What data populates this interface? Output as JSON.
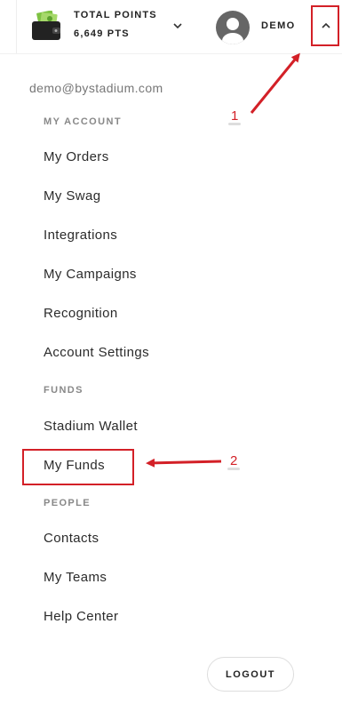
{
  "header": {
    "points_label": "TOTAL POINTS",
    "points_value": "6,649 PTS",
    "username": "DEMO"
  },
  "menu": {
    "email": "demo@bystadium.com",
    "my_account_heading": "MY ACCOUNT",
    "my_account_items": [
      "My Orders",
      "My Swag",
      "Integrations",
      "My Campaigns",
      "Recognition",
      "Account Settings"
    ],
    "funds_heading": "FUNDS",
    "funds_items": [
      "Stadium Wallet",
      "My Funds"
    ],
    "people_heading": "PEOPLE",
    "people_items": [
      "Contacts",
      "My Teams",
      "Help Center"
    ],
    "logout_label": "LOGOUT"
  },
  "annotations": {
    "callout_1": "1",
    "callout_2": "2",
    "color": "#d32027"
  },
  "icons": [
    "wallet-icon",
    "chevron-down-icon",
    "avatar-icon",
    "chevron-up-icon"
  ]
}
